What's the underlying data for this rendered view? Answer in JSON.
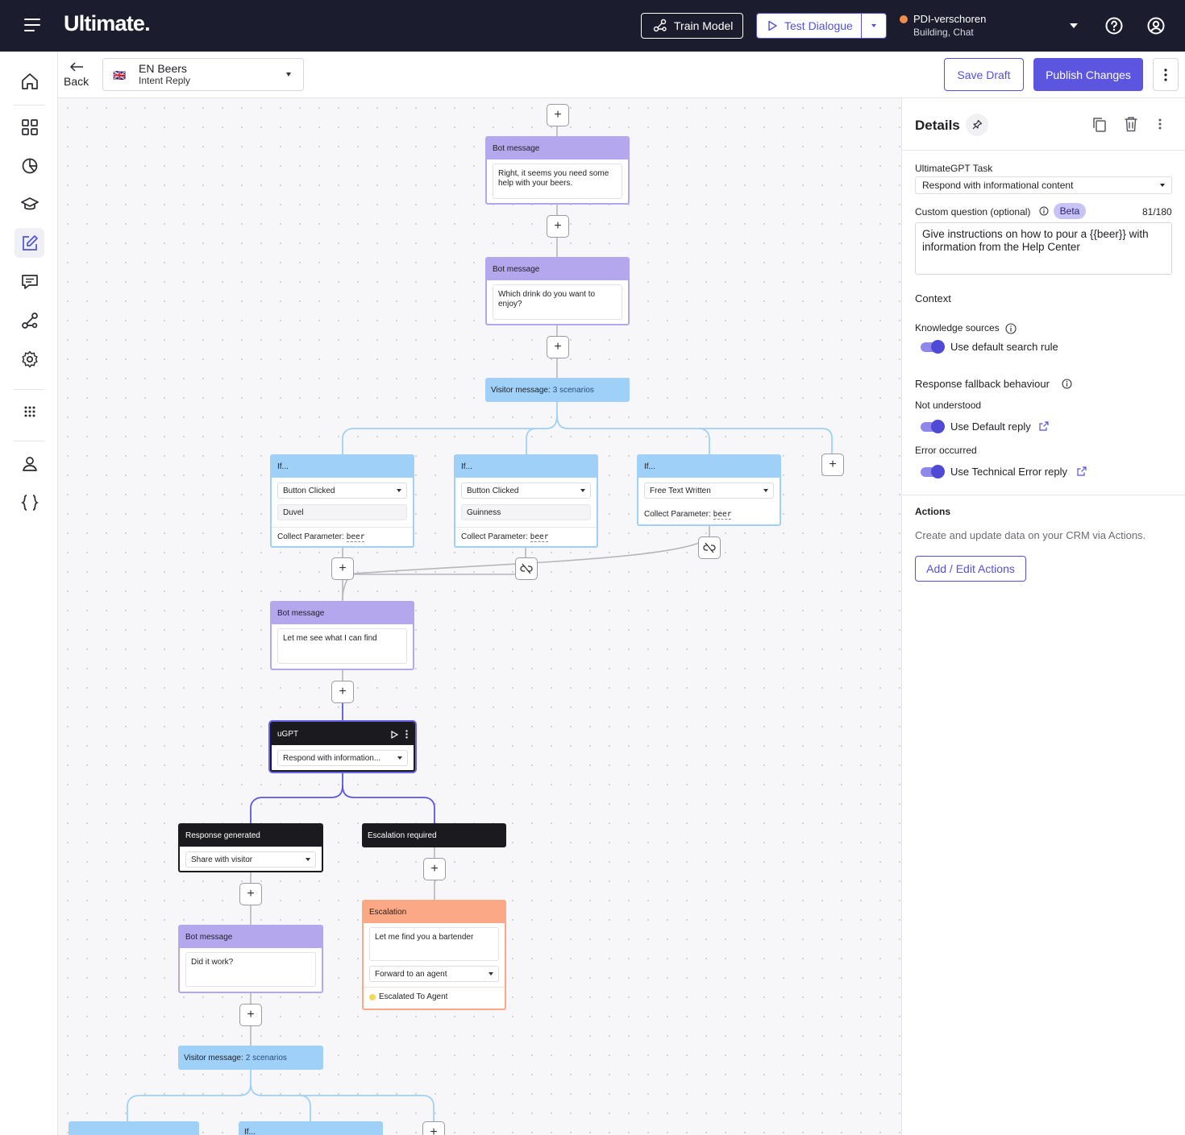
{
  "header": {
    "logo": "Ultimate.",
    "train_model": "Train Model",
    "test_dialogue": "Test Dialogue",
    "workspace_name": "PDI-verschoren",
    "workspace_sub": "Building, Chat",
    "colors": {
      "topbar": "#1b1d2e",
      "accent": "#5c55e0",
      "workspace_dot": "#f28c4b"
    }
  },
  "sidebar": {
    "items": [
      "home-icon",
      "dashboard-icon",
      "analytics-icon",
      "training-icon",
      "edit-icon",
      "conversations-icon",
      "integrations-icon",
      "settings-icon",
      "apps-icon",
      "user-icon",
      "variables-icon"
    ]
  },
  "subheader": {
    "back": "Back",
    "intent_title": "EN Beers",
    "intent_sub": "Intent Reply",
    "flag": "🇬🇧",
    "save_draft": "Save Draft",
    "publish": "Publish Changes"
  },
  "flow": {
    "bot1": {
      "header": "Bot message",
      "text": "Right, it seems you need some help with your beers."
    },
    "bot2": {
      "header": "Bot message",
      "text": "Which drink do you want to enjoy?"
    },
    "vm1": {
      "label": "Visitor message:",
      "count": "3 scenarios"
    },
    "if1": {
      "header": "If...",
      "select": "Button Clicked",
      "value": "Duvel",
      "collect_label": "Collect Parameter:",
      "param": "beer"
    },
    "if2": {
      "header": "If...",
      "select": "Button Clicked",
      "value": "Guinness",
      "collect_label": "Collect Parameter:",
      "param": "beer"
    },
    "if3": {
      "header": "If...",
      "select": "Free Text Written",
      "collect_label": "Collect Parameter:",
      "param": "beer"
    },
    "bot3": {
      "header": "Bot message",
      "text": "Let me see what I can find"
    },
    "ugpt": {
      "header": "uGPT",
      "select": "Respond with information..."
    },
    "resp": {
      "header": "Response generated",
      "select": "Share with visitor"
    },
    "escreq": {
      "header": "Escalation required"
    },
    "bot4": {
      "header": "Bot message",
      "text": "Did it work?"
    },
    "esc": {
      "header": "Escalation",
      "text": "Let me find you a bartender",
      "select": "Forward to an agent",
      "status": "Escalated To Agent"
    },
    "vm2": {
      "label": "Visitor message:",
      "count": "2 scenarios"
    },
    "if4": {
      "header": "If..."
    },
    "plus": "+",
    "colors": {
      "bot": "#b4a7ee",
      "condition": "#9fd0f7",
      "dark": "#1b1b1f",
      "escalation": "#fba985",
      "ugpt_edge": "#6a63e6"
    }
  },
  "panel": {
    "title": "Details",
    "task_label": "UltimateGPT Task",
    "task_value": "Respond with informational content",
    "custom_label": "Custom question (optional)",
    "beta": "Beta",
    "char_count": "81/180",
    "custom_text": "Give instructions on how to pour a {{beer}} with information from the Help Center",
    "context": "Context",
    "knowledge_label": "Knowledge sources",
    "knowledge_toggle": "Use default search rule",
    "fallback_label": "Response fallback behaviour",
    "not_understood": "Not understood",
    "default_reply": "Use Default reply",
    "error_occurred": "Error occurred",
    "tech_error": "Use Technical Error reply",
    "actions_label": "Actions",
    "actions_desc": "Create and update data on your CRM via Actions.",
    "actions_button": "Add / Edit Actions"
  }
}
